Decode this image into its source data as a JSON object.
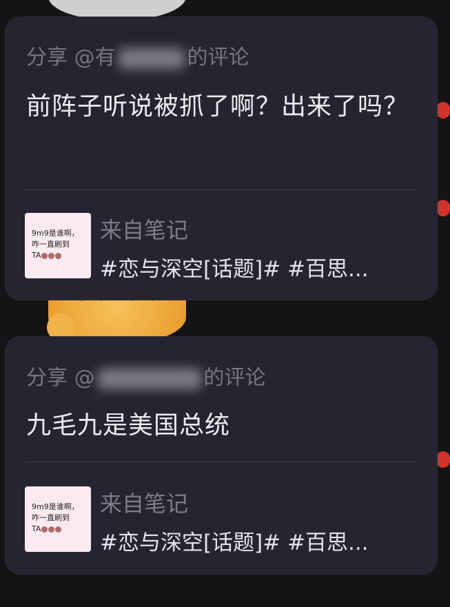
{
  "comments": [
    {
      "share_prefix": "分享 @",
      "share_name_visible": "有",
      "share_suffix": "的评论",
      "text": "前阵子听说被抓了啊？出来了吗？",
      "note": {
        "thumb_line1": "9m9是谁啊，",
        "thumb_line2": "咋一直刷到",
        "thumb_line3": "TA",
        "source_label": "来自笔记",
        "tags": "#恋与深空[话题]# #百思..."
      }
    },
    {
      "share_prefix": "分享 @",
      "share_name_visible": "",
      "share_suffix": "的评论",
      "text": "九毛九是美国总统",
      "note": {
        "thumb_line1": "9m9是谁啊，",
        "thumb_line2": "咋一直刷到",
        "thumb_line3": "TA",
        "source_label": "来自笔记",
        "tags": "#恋与深空[话题]# #百思..."
      }
    }
  ]
}
